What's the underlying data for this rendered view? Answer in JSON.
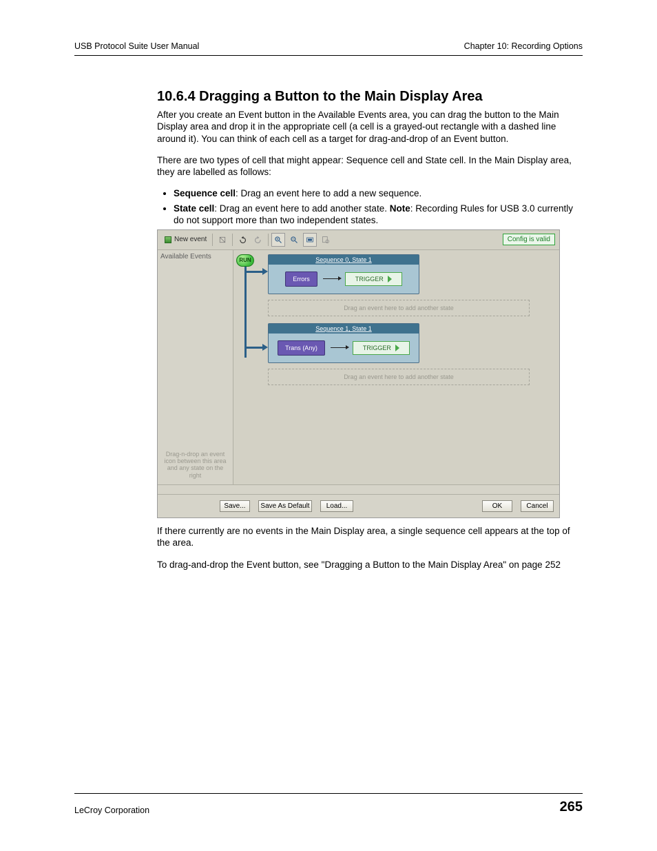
{
  "header": {
    "left": "USB Protocol Suite User Manual",
    "right": "Chapter 10: Recording Options"
  },
  "section": {
    "title": "10.6.4 Dragging a Button to the Main Display Area",
    "para1": "After you create an Event button in the Available Events area, you can drag the button to the Main Display area and drop it in the appropriate cell (a cell is a grayed-out rectangle with a dashed line around it). You can think of each cell as a target for drag-and-drop of an Event button.",
    "para2": "There are two types of cell that might appear: Sequence cell and State cell. In the Main Display area, they are labelled as follows:",
    "bullet1_label": "Sequence cell",
    "bullet1_rest": ": Drag an event here to add a new sequence.",
    "bullet2_label": "State cell",
    "bullet2_rest1": ": Drag an event here to add another state. ",
    "bullet2_note": "Note",
    "bullet2_rest2": ": Recording Rules for USB 3.0 currently do not support more than two independent states.",
    "para3": "If there currently are no events in the Main Display area, a single sequence cell appears at the top of the area.",
    "para4": "To drag-and-drop the Event button, see \"Dragging a Button to the Main Display Area\" on page 252"
  },
  "app": {
    "toolbar": {
      "new_event": "New event",
      "status": "Config is valid"
    },
    "sidebar": {
      "title": "Available Events",
      "hint": "Drag-n-drop an event icon between this area and any state on the right"
    },
    "canvas": {
      "run": "RUN",
      "seq0": {
        "title": "Sequence 0, State 1",
        "event": "Errors",
        "action": "TRIGGER"
      },
      "drop_hint": "Drag an event here to add another state",
      "seq1": {
        "title": "Sequence 1, State 1",
        "event": "Trans (Any)",
        "action": "TRIGGER"
      }
    },
    "buttons": {
      "save": "Save...",
      "save_default": "Save As Default",
      "load": "Load...",
      "ok": "OK",
      "cancel": "Cancel"
    }
  },
  "footer": {
    "corp": "LeCroy Corporation",
    "page": "265"
  }
}
